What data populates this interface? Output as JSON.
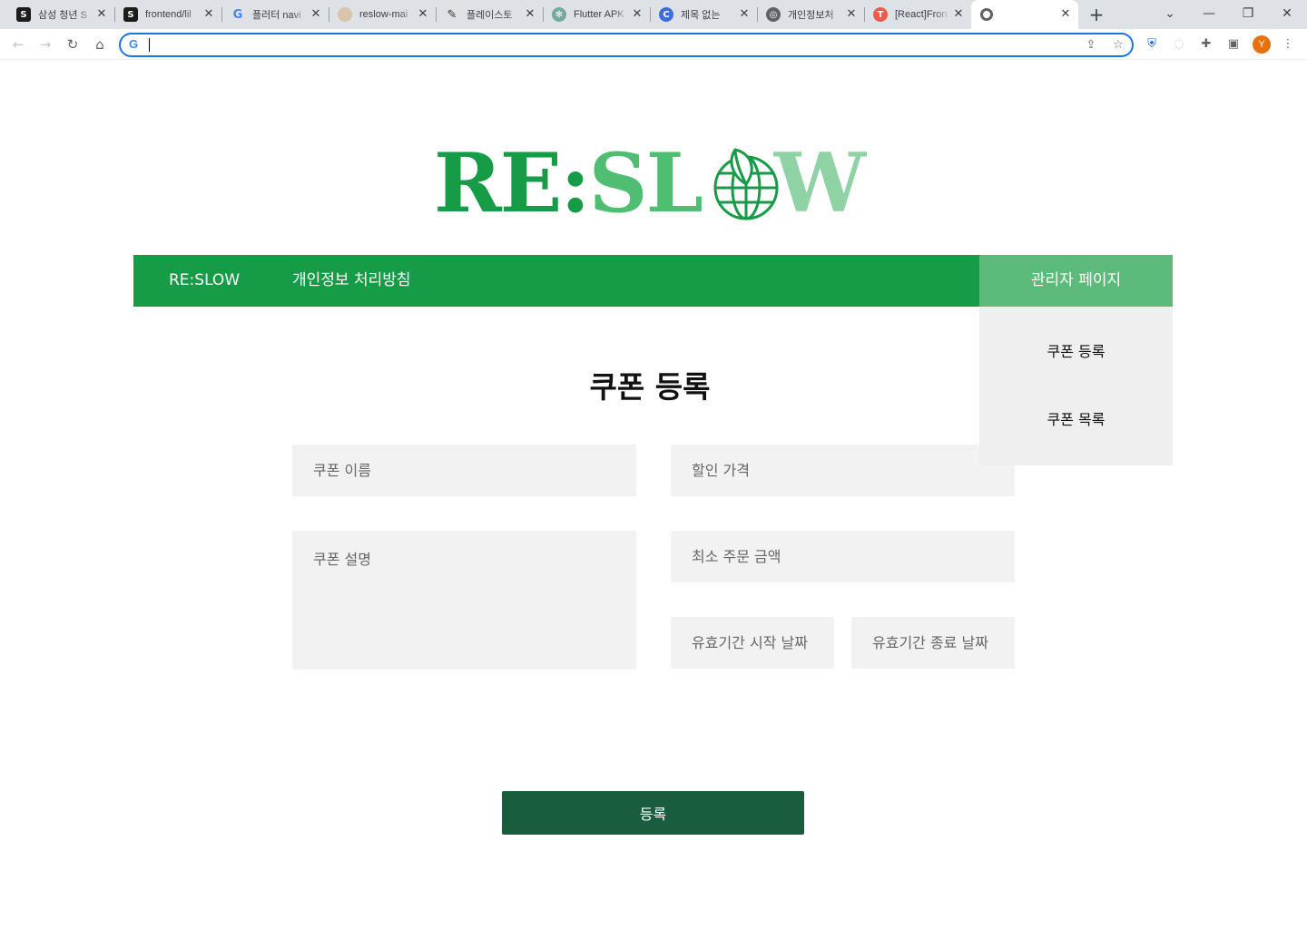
{
  "browser": {
    "tabs": [
      {
        "title": "삼성 청년 S",
        "favicon": "slack-icon"
      },
      {
        "title": "frontend/lil",
        "favicon": "slack-icon"
      },
      {
        "title": "플러터 navi",
        "favicon": "google-icon"
      },
      {
        "title": "reslow-mai",
        "favicon": "github-avatar-icon"
      },
      {
        "title": "플레이스토",
        "favicon": "notion-icon"
      },
      {
        "title": "Flutter APK",
        "favicon": "chatgpt-icon"
      },
      {
        "title": "제목 없는",
        "favicon": "canva-icon"
      },
      {
        "title": "개인정보처",
        "favicon": "globe-icon"
      },
      {
        "title": "[React]Fron",
        "favicon": "tistory-icon"
      },
      {
        "title": "",
        "favicon": "chrome-icon"
      }
    ],
    "new_tab_symbol": "+",
    "address": "",
    "google_letter": "G",
    "profile_initial": "Y",
    "accent_color": "#1a73e8"
  },
  "brand": {
    "logo_part1": "RE:",
    "logo_part2": "SL",
    "logo_part3": "W",
    "colors": {
      "dark": "#169b47",
      "mid": "#4fbd72",
      "light": "#8fd3a4"
    }
  },
  "nav": {
    "home": "RE:SLOW",
    "privacy": "개인정보 처리방침",
    "admin": "관리자 페이지",
    "dropdown": [
      "쿠폰 등록",
      "쿠폰 목록"
    ],
    "bar_color": "#169b47",
    "admin_color": "#5cbb7b"
  },
  "form": {
    "title": "쿠폰 등록",
    "name_placeholder": "쿠폰 이름",
    "discount_placeholder": "할인 가격",
    "description_placeholder": "쿠폰 설명",
    "min_order_placeholder": "최소 주문 금액",
    "start_date_placeholder": "유효기간 시작 날짜",
    "end_date_placeholder": "유효기간 종료 날짜",
    "submit_label": "등록",
    "submit_color": "#1a5c3e"
  }
}
